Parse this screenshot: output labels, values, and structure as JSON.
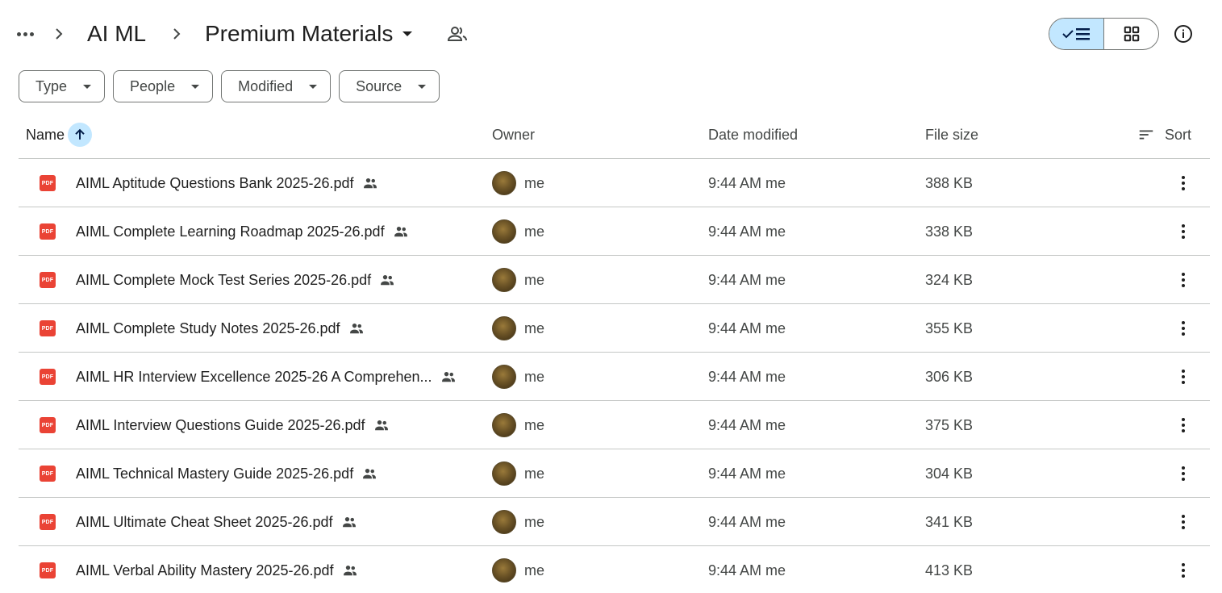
{
  "breadcrumb": {
    "parent": "AI ML",
    "current": "Premium Materials"
  },
  "filters": [
    "Type",
    "People",
    "Modified",
    "Source"
  ],
  "table": {
    "columns": {
      "name": "Name",
      "owner": "Owner",
      "date": "Date modified",
      "size": "File size",
      "sort": "Sort"
    },
    "rows": [
      {
        "name": "AIML Aptitude Questions Bank 2025-26.pdf",
        "owner": "me",
        "date": "9:44 AM me",
        "size": "388 KB"
      },
      {
        "name": "AIML Complete Learning Roadmap 2025-26.pdf",
        "owner": "me",
        "date": "9:44 AM me",
        "size": "338 KB"
      },
      {
        "name": "AIML Complete Mock Test Series 2025-26.pdf",
        "owner": "me",
        "date": "9:44 AM me",
        "size": "324 KB"
      },
      {
        "name": "AIML Complete Study Notes 2025-26.pdf",
        "owner": "me",
        "date": "9:44 AM me",
        "size": "355 KB"
      },
      {
        "name": "AIML HR Interview Excellence 2025-26 A Comprehen...",
        "owner": "me",
        "date": "9:44 AM me",
        "size": "306 KB"
      },
      {
        "name": "AIML Interview Questions Guide 2025-26.pdf",
        "owner": "me",
        "date": "9:44 AM me",
        "size": "375 KB"
      },
      {
        "name": "AIML Technical Mastery Guide 2025-26.pdf",
        "owner": "me",
        "date": "9:44 AM me",
        "size": "304 KB"
      },
      {
        "name": "AIML Ultimate Cheat Sheet 2025-26.pdf",
        "owner": "me",
        "date": "9:44 AM me",
        "size": "341 KB"
      },
      {
        "name": "AIML Verbal Ability Mastery 2025-26.pdf",
        "owner": "me",
        "date": "9:44 AM me",
        "size": "413 KB"
      }
    ]
  },
  "icons": {
    "file_type": "pdf-icon",
    "file_type_label": "PDF",
    "shared": "people-icon",
    "sort_direction": "arrow-up-icon"
  },
  "colors": {
    "accent": "#c2e7ff",
    "pdf": "#ea4335",
    "divider": "#c4c7c5"
  }
}
